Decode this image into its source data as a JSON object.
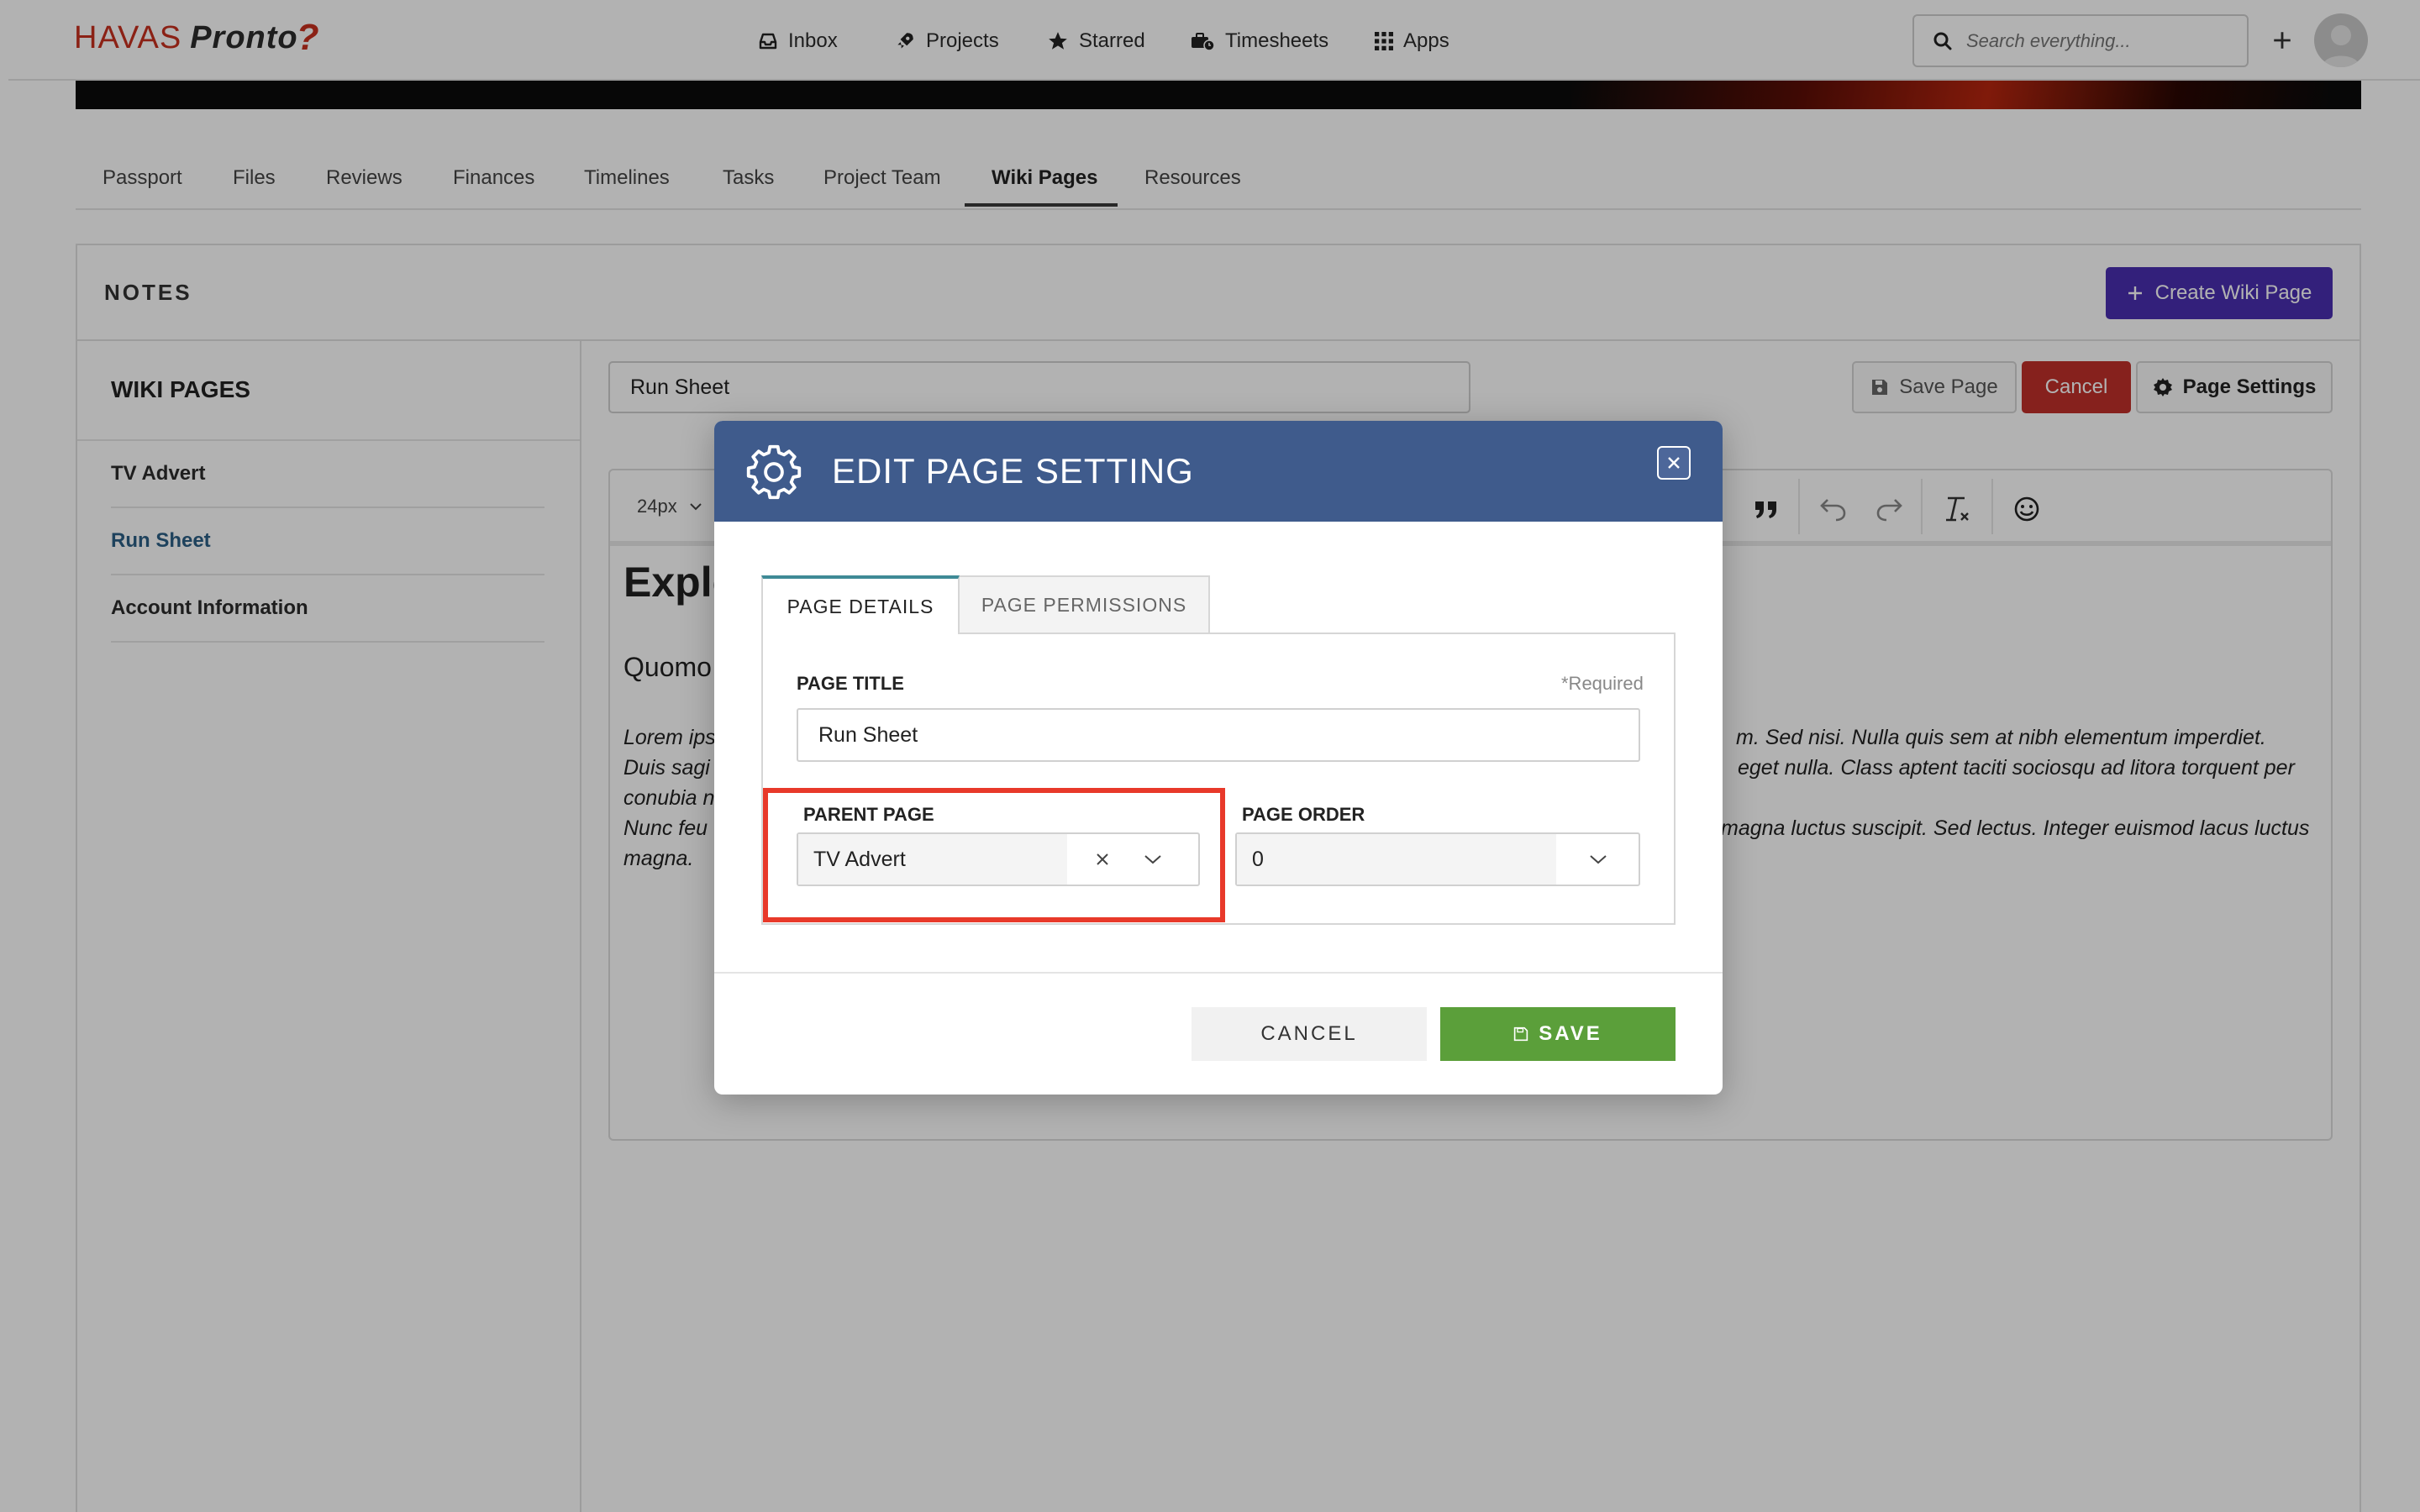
{
  "brand": {
    "name_part1": "HAVAS",
    "name_part2": "Pronto",
    "mark": "?"
  },
  "nav": {
    "items": [
      {
        "label": "Inbox",
        "icon": "inbox-icon"
      },
      {
        "label": "Projects",
        "icon": "rocket-icon"
      },
      {
        "label": "Starred",
        "icon": "star-icon"
      },
      {
        "label": "Timesheets",
        "icon": "timesheets-icon"
      },
      {
        "label": "Apps",
        "icon": "grid-icon"
      }
    ],
    "search_placeholder": "Search everything..."
  },
  "project_tabs": [
    "Passport",
    "Files",
    "Reviews",
    "Finances",
    "Timelines",
    "Tasks",
    "Project Team",
    "Wiki Pages",
    "Resources"
  ],
  "active_tab": "Wiki Pages",
  "notes": {
    "title": "NOTES",
    "create_button": "Create Wiki Page",
    "wiki_heading": "WIKI PAGES",
    "wiki_items": [
      "TV Advert",
      "Run Sheet",
      "Account Information"
    ],
    "active_item": "Run Sheet"
  },
  "editor": {
    "title_value": "Run Sheet",
    "save_page": "Save Page",
    "cancel": "Cancel",
    "page_settings": "Page Settings",
    "font_size": "24px",
    "heading_fragment": "Explo",
    "sub_fragment": "Quomo",
    "left_lines": [
      "Lorem ips",
      "Duis sagi",
      "conubia n",
      "Nunc feu",
      "magna."
    ],
    "right_lines": [
      "m. Sed nisi. Nulla quis sem at nibh elementum imperdiet.",
      "eget nulla. Class aptent taciti sociosqu ad litora torquent per",
      "",
      "magna luctus suscipit. Sed lectus. Integer euismod lacus luctus"
    ]
  },
  "modal": {
    "title": "EDIT PAGE SETTING",
    "tabs": [
      "PAGE DETAILS",
      "PAGE PERMISSIONS"
    ],
    "page_title_label": "PAGE TITLE",
    "required_note": "*Required",
    "page_title_value": "Run Sheet",
    "parent_page_label": "PARENT PAGE",
    "parent_page_value": "TV Advert",
    "page_order_label": "PAGE ORDER",
    "page_order_value": "0",
    "cancel_label": "CANCEL",
    "save_label": "SAVE"
  },
  "colors": {
    "modal_header": "#3f5b8c",
    "save_green": "#5b9f3a",
    "create_purple": "#4a2fb0",
    "cancel_red": "#c0302a",
    "highlight": "#e8392a"
  }
}
